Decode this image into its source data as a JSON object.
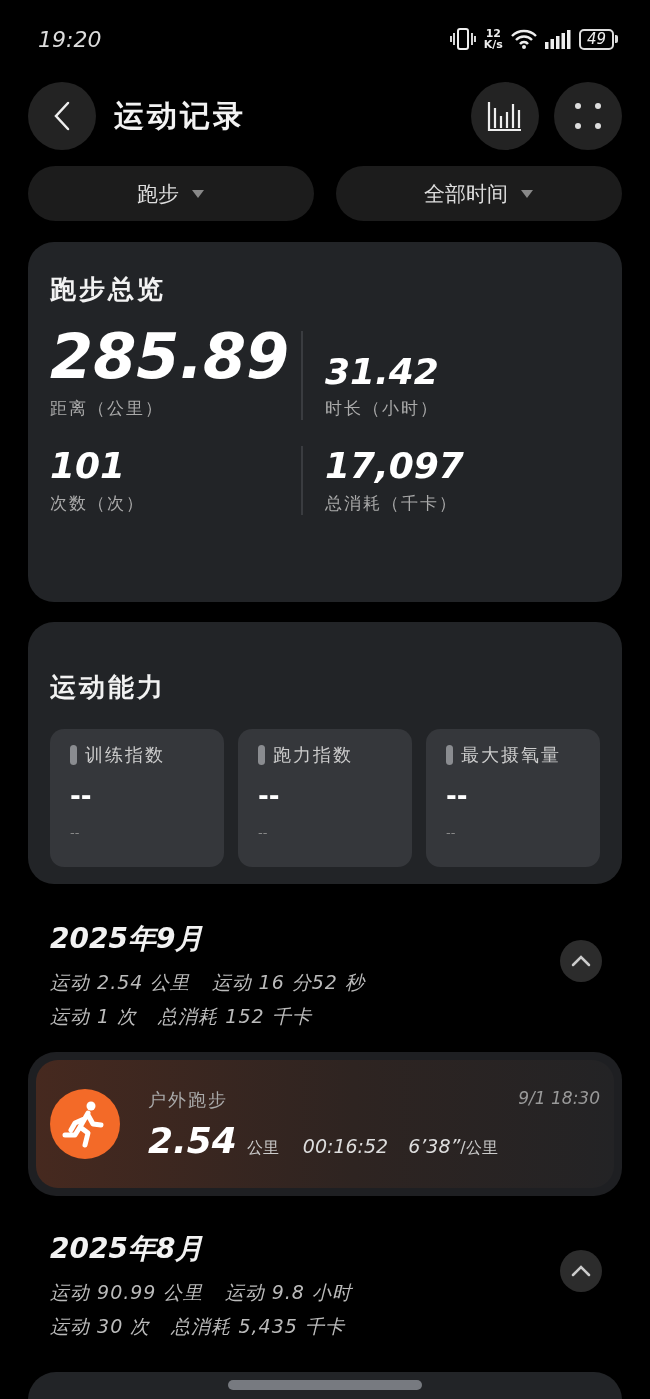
{
  "status_bar": {
    "time": "19:20",
    "speed_value": "12",
    "speed_unit": "K/s",
    "battery": "49"
  },
  "header": {
    "title": "运动记录"
  },
  "filters": [
    {
      "label": "跑步"
    },
    {
      "label": "全部时间"
    }
  ],
  "summary": {
    "title": "跑步总览",
    "stats": [
      {
        "value": "285.89",
        "label": "距离（公里）",
        "kind": "big"
      },
      {
        "value": "31.42",
        "label": "时长（小时）",
        "kind": "normal"
      },
      {
        "value": "101",
        "label": "次数（次）",
        "kind": "normal"
      },
      {
        "value": "17,097",
        "label": "总消耗（千卡）",
        "kind": "normal"
      }
    ]
  },
  "ability": {
    "title": "运动能力",
    "metrics": [
      {
        "label": "训练指数",
        "value": "--",
        "sub": "--"
      },
      {
        "label": "跑力指数",
        "value": "--",
        "sub": "--"
      },
      {
        "label": "最大摄氧量",
        "value": "--",
        "sub": "--"
      }
    ]
  },
  "months": [
    {
      "title": "2025年9月",
      "lines": [
        "运动 2.54 公里   运动 16 分52 秒",
        "运动 1 次   总消耗 152 千卡"
      ],
      "expanded": true,
      "activities": [
        {
          "name": "户外跑步",
          "distance": "2.54",
          "unit": "公里",
          "duration": "00:16:52",
          "pace": "6’38”",
          "pace_unit": "/公里",
          "time": "9/1 18:30"
        }
      ]
    },
    {
      "title": "2025年8月",
      "lines": [
        "运动 90.99 公里   运动 9.8 小时",
        "运动 30 次   总消耗 5,435 千卡"
      ],
      "expanded": true
    }
  ]
}
